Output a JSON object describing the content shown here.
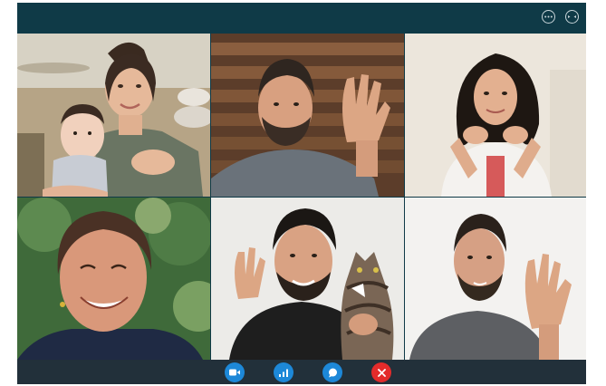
{
  "window": {
    "title_buttons": [
      {
        "icon": "ellipsis-icon"
      },
      {
        "icon": "fullscreen-icon"
      }
    ]
  },
  "participants": [
    {
      "position": "top-left",
      "icon": "video-feed"
    },
    {
      "position": "top-center",
      "icon": "video-feed"
    },
    {
      "position": "top-right",
      "icon": "video-feed"
    },
    {
      "position": "bottom-left",
      "icon": "video-feed"
    },
    {
      "position": "bottom-center",
      "icon": "video-feed"
    },
    {
      "position": "bottom-right",
      "icon": "video-feed"
    }
  ],
  "controls": [
    {
      "icon": "video-camera-icon",
      "color": "#1d88d8"
    },
    {
      "icon": "signal-bars-icon",
      "color": "#1d88d8"
    },
    {
      "icon": "chat-bubble-icon",
      "color": "#1d88d8"
    },
    {
      "icon": "end-call-icon",
      "color": "#e32b2b"
    }
  ],
  "colors": {
    "window_background": "#0f3a47",
    "control_bar": "#22303a",
    "accent_blue": "#1d88d8",
    "hangup_red": "#e32b2b"
  }
}
